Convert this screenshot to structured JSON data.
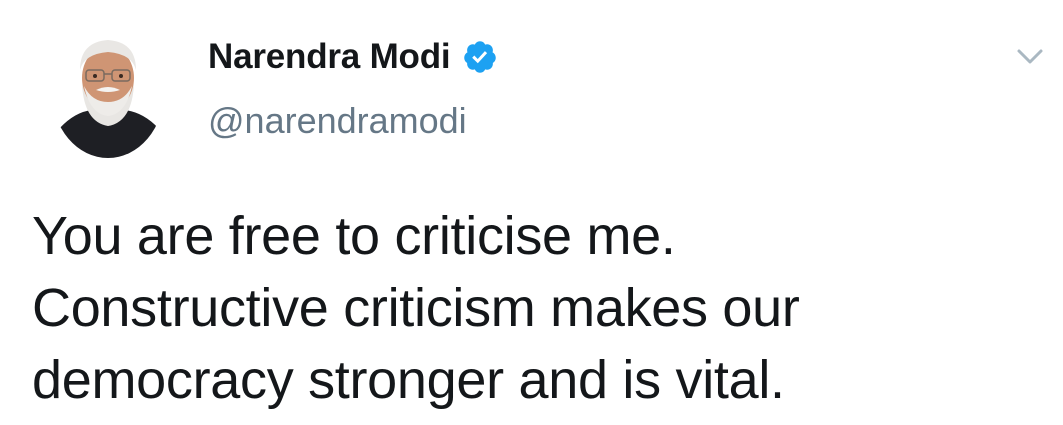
{
  "author": {
    "display_name": "Narendra Modi",
    "handle": "@narendramodi",
    "verified": true,
    "avatar_icon": "profile-photo",
    "verified_icon": "verified-badge-icon",
    "verified_color": "#1da1f2"
  },
  "menu": {
    "icon": "chevron-down-icon"
  },
  "tweet": {
    "lines": [
      "You are free to criticise me.",
      "Constructive criticism makes our",
      "democracy stronger and is vital."
    ]
  },
  "colors": {
    "text": "#14171a",
    "secondary": "#657786",
    "background": "#ffffff"
  }
}
